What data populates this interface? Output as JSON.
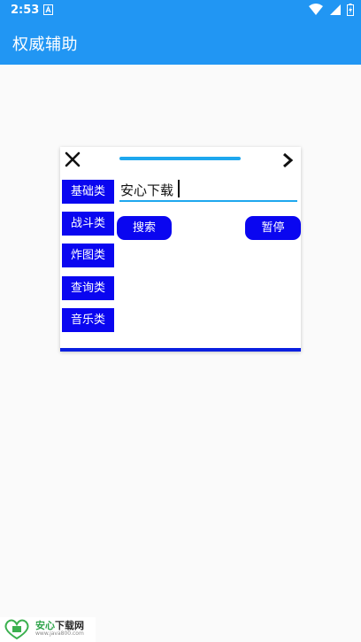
{
  "status_bar": {
    "time": "2:53",
    "icons": [
      "notification-a-icon",
      "wifi-icon",
      "signal-icon",
      "battery-charging-icon"
    ]
  },
  "app_bar": {
    "title": "权威辅助",
    "color": "#2196f3"
  },
  "panel": {
    "categories": [
      "基础类",
      "战斗类",
      "炸图类",
      "查询类",
      "音乐类"
    ],
    "search": {
      "value": "安心下载",
      "search_label": "搜索",
      "pause_label": "暂停"
    },
    "accent_color": "#0a06f0",
    "handle_color": "#1ea7ee"
  },
  "watermark": {
    "title_green": "安心",
    "title_dark": "下载网",
    "url": "www.java800.com"
  }
}
